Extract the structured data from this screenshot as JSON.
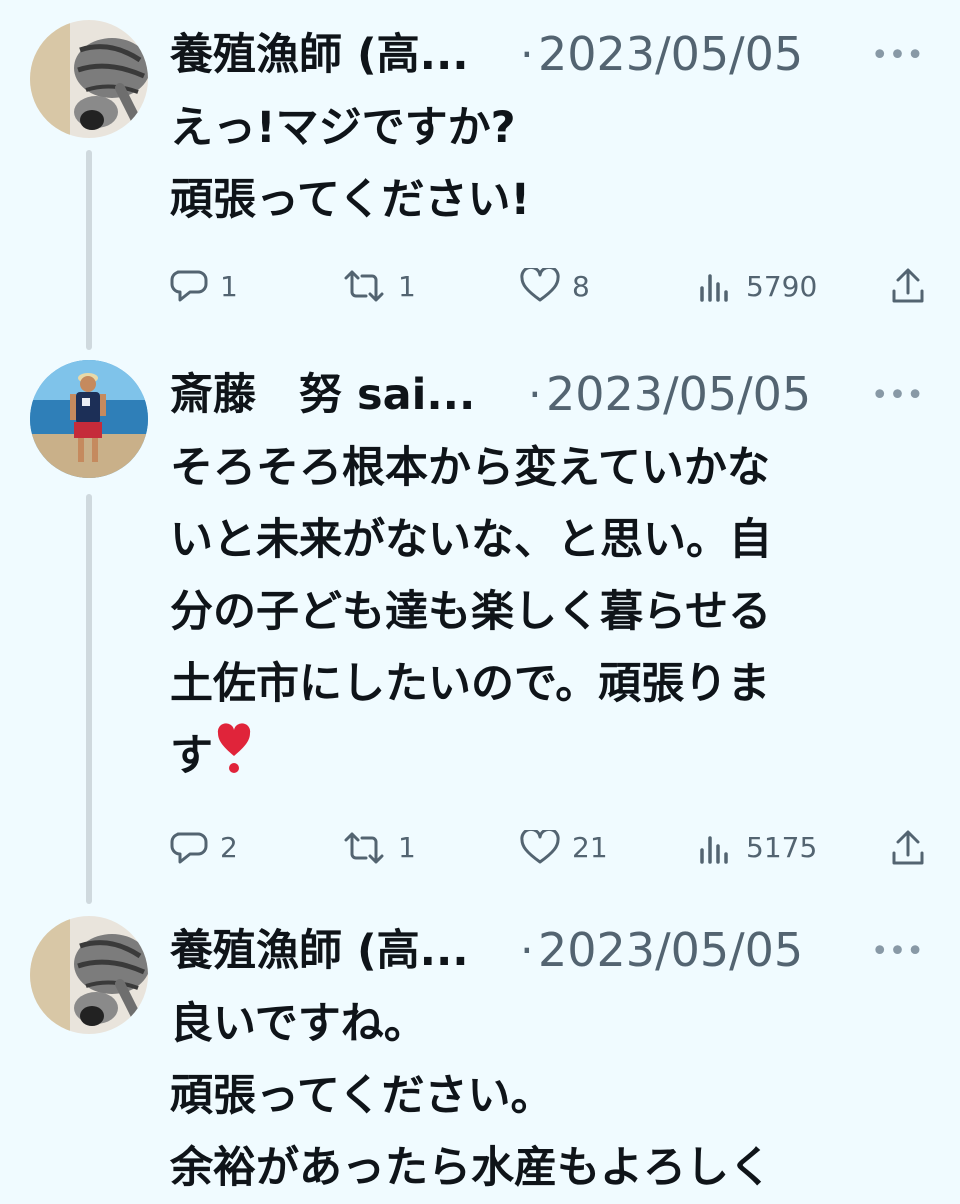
{
  "colors": {
    "background": "#f0fbff",
    "text": "#0f1419",
    "secondary": "#536471",
    "thread_line": "#cfd9de"
  },
  "tweets": [
    {
      "author": "養殖漁師 (高...",
      "separator": "·",
      "date": "2023/05/05",
      "more_icon": "more-dots-icon",
      "avatar": "cat-avatar",
      "lines": [
        "えっ!マジですか?",
        "頑張ってください!"
      ],
      "replies": "1",
      "retweets": "1",
      "likes": "8",
      "views": "5790"
    },
    {
      "author": "斎藤　努 sai...",
      "separator": "·",
      "date": "2023/05/05",
      "more_icon": "more-dots-icon",
      "avatar": "beach-person-avatar",
      "lines": [
        "そろそろ根本から変えていかな",
        "いと未来がないな、と思い。自",
        "分の子ども達も楽しく暮らせる",
        "土佐市にしたいので。頑張りま",
        "す"
      ],
      "emoji": "❣️",
      "replies": "2",
      "retweets": "1",
      "likes": "21",
      "views": "5175"
    },
    {
      "author": "養殖漁師 (高...",
      "separator": "·",
      "date": "2023/05/05",
      "more_icon": "more-dots-icon",
      "avatar": "cat-avatar",
      "lines": [
        "良いですね。",
        "頑張ってください。",
        "余裕があったら水産もよろしく"
      ]
    }
  ]
}
